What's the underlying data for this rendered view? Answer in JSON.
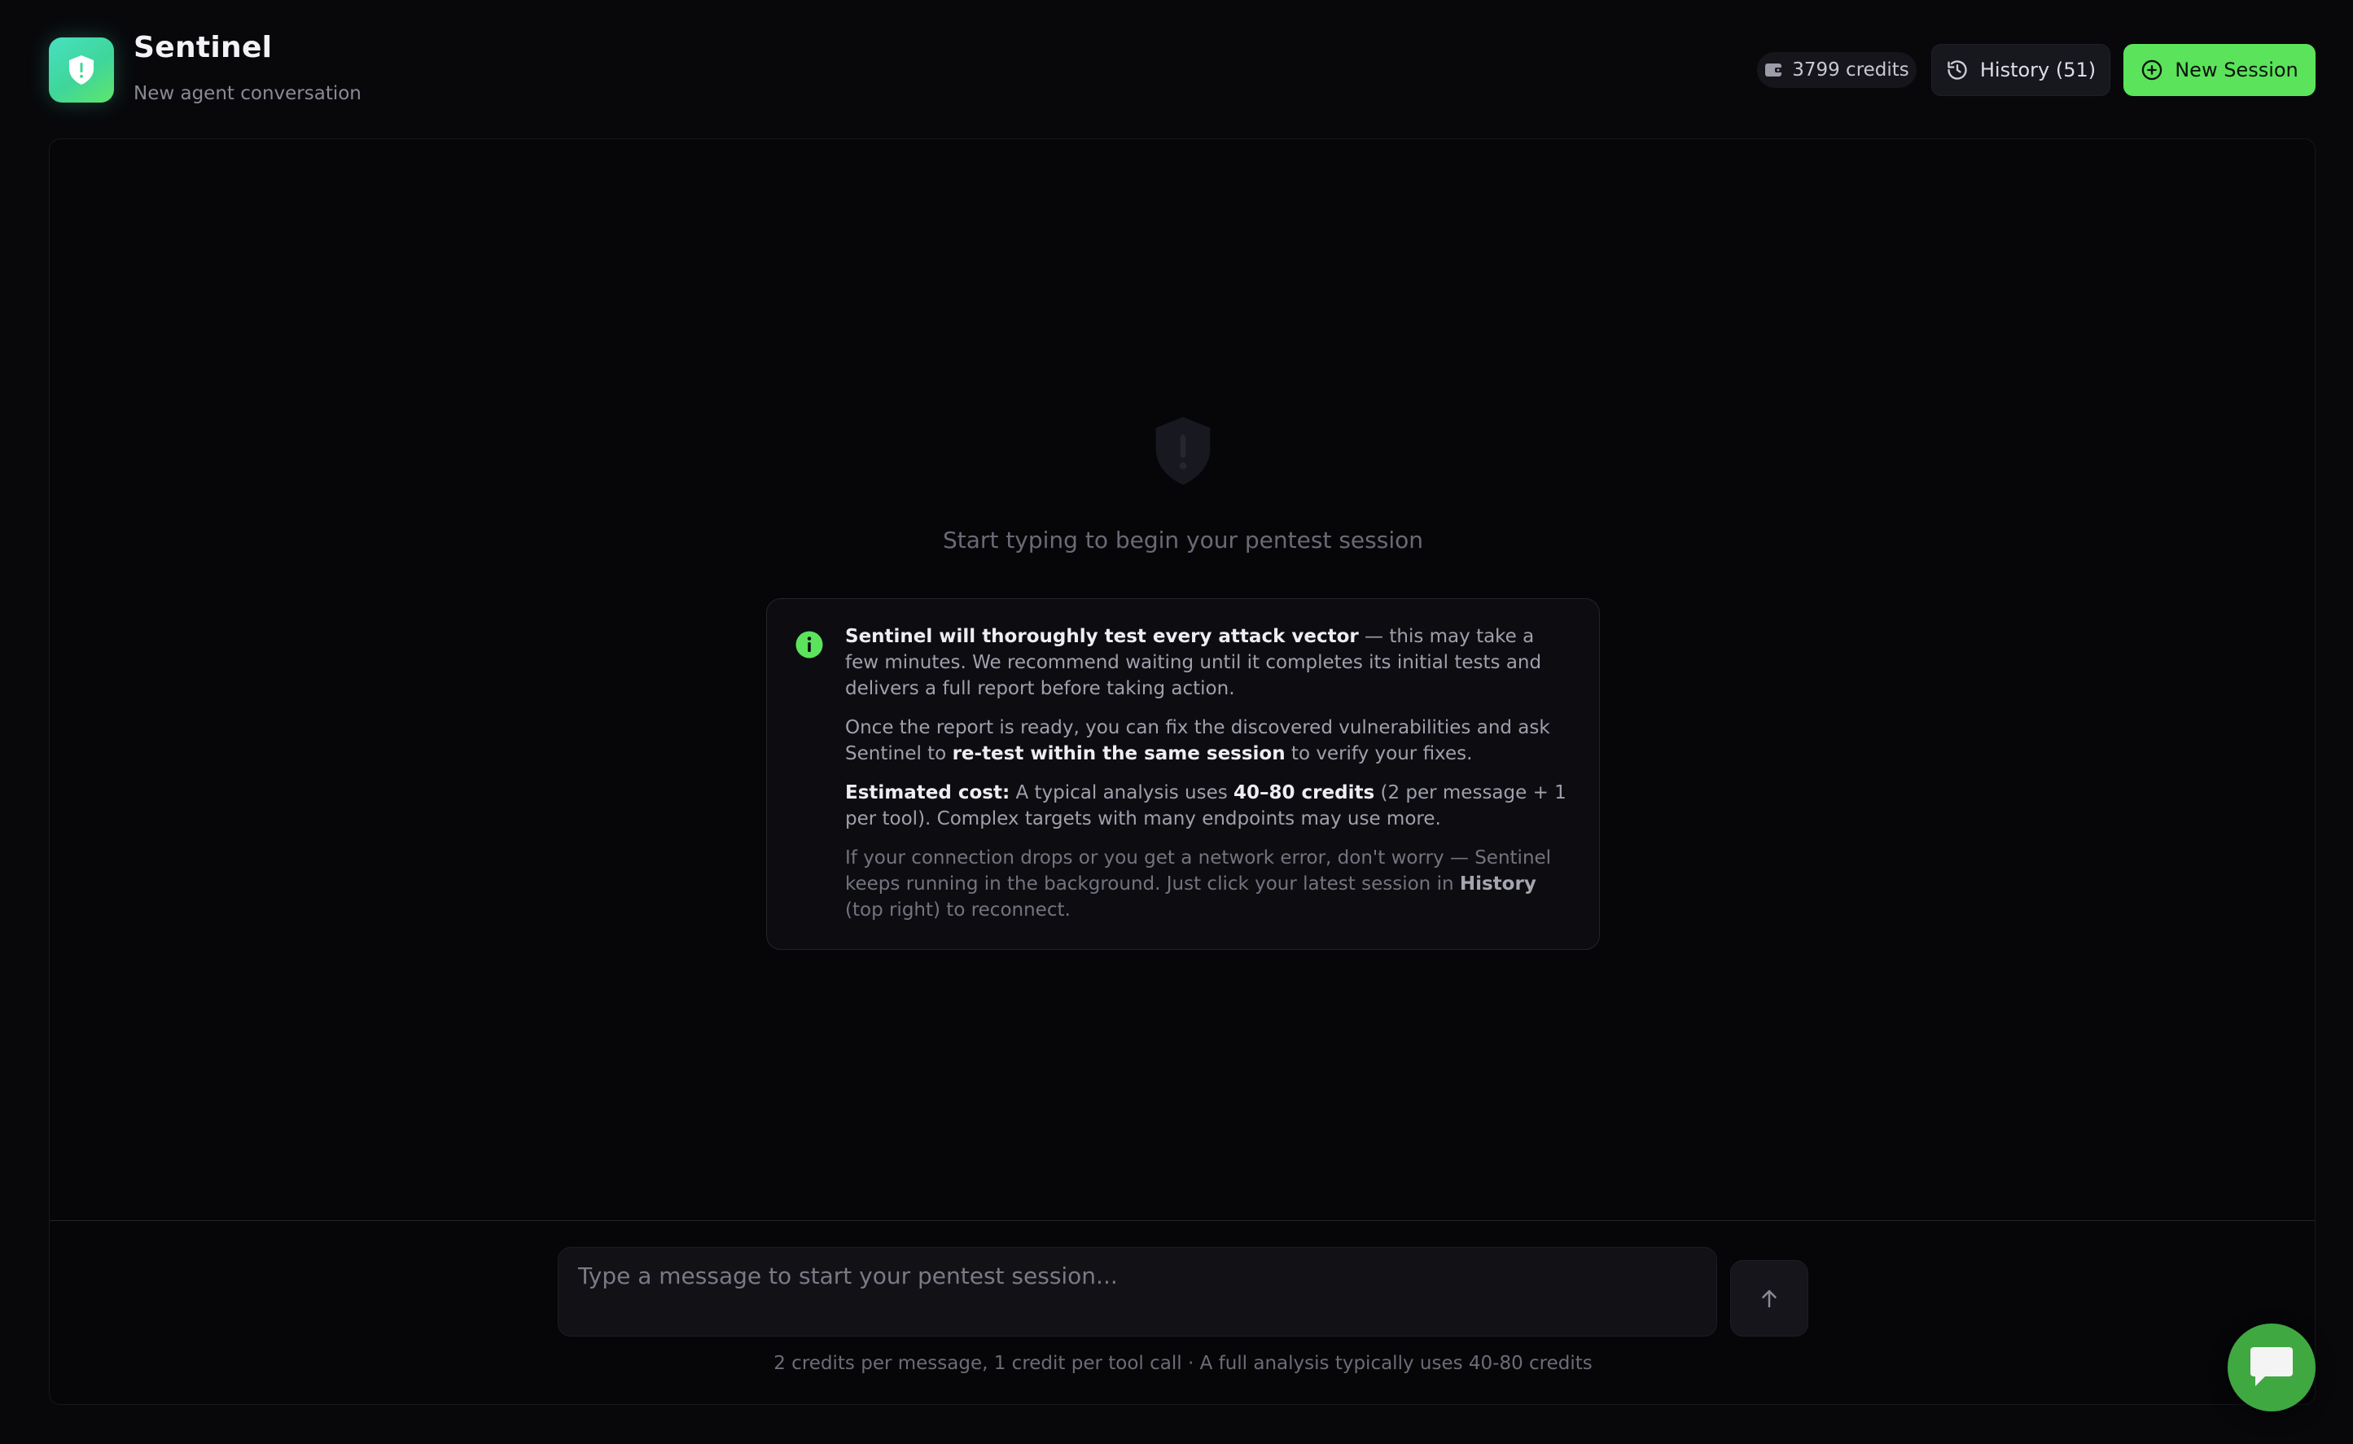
{
  "app": {
    "title": "Sentinel",
    "subtitle": "New agent conversation"
  },
  "header": {
    "credits_label": "3799 credits",
    "history_label": "History (51)",
    "new_session_label": "New Session"
  },
  "empty_state": {
    "prompt": "Start typing to begin your pentest session"
  },
  "info_card": {
    "p1_bold": "Sentinel will thoroughly test every attack vector",
    "p1_rest": " — this may take a few minutes. We recommend waiting until it completes its initial tests and delivers a full report before taking action.",
    "p2_pre": "Once the report is ready, you can fix the discovered vulnerabilities and ask Sentinel to ",
    "p2_bold": "re-test within the same session",
    "p2_post": " to verify your fixes.",
    "p3_label": "Estimated cost:",
    "p3_pre": " A typical analysis uses ",
    "p3_bold": "40–80 credits",
    "p3_post": " (2 per message + 1 per tool). Complex targets with many endpoints may use more.",
    "p4_pre": "If your connection drops or you get a network error, don't worry — Sentinel keeps running in the background. Just click your latest session in ",
    "p4_bold": "History",
    "p4_post": " (top right) to reconnect."
  },
  "composer": {
    "placeholder": "Type a message to start your pentest session...",
    "value": "",
    "hint": "2 credits per message, 1 credit per tool call · A full analysis typically uses 40-80 credits"
  },
  "icons": {
    "logo": "shield-alert-icon",
    "credits": "wallet-icon",
    "history": "clock-history-icon",
    "new_session": "plus-circle-icon",
    "empty_state": "shield-alert-icon",
    "info": "info-icon",
    "send": "arrow-up-icon",
    "chat": "chat-bubble-icon"
  },
  "colors": {
    "background": "#08080b",
    "panel": "#060609",
    "accent": "#5be35b",
    "logo_gradient_start": "#47e0c0",
    "logo_gradient_end": "#5fe66a",
    "chat_launcher": "#3fa841"
  }
}
